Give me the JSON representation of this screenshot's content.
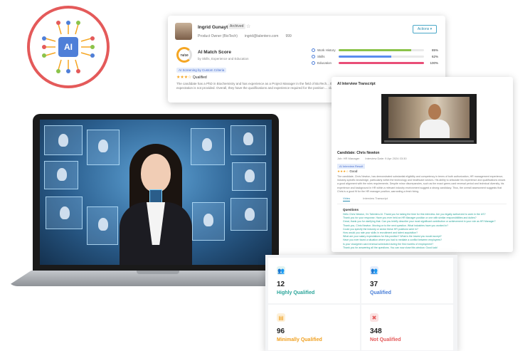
{
  "logo": {
    "text": "AI"
  },
  "profile": {
    "name": "Ingrid Gunayte",
    "badge": "Archived",
    "title": "Product Owner (BioTech)",
    "email": "ingrid@talentero.com",
    "extra": "999",
    "actions_label": "Actions ▾",
    "score_value": "74/10",
    "score_title": "AI Match Score",
    "score_sub": "by Skills, Experience and Education",
    "tag": "AI Screening by Custom Criteria",
    "rating_stars": "★★★☆",
    "rating_label": "Qualified",
    "description": "The candidate has a PhD in Biochemistry and has experience as a Project Manager in the field of BioTech... their salary expectation is not provided. Overall, they have the qualifications and experience required for the position ... clarification.",
    "metrics": [
      {
        "label": "Work History",
        "value": "85%",
        "fraction": 0.85,
        "color": "#8bc34a"
      },
      {
        "label": "Skills",
        "value": "62%",
        "fraction": 0.62,
        "color": "#5b8def"
      },
      {
        "label": "Education",
        "value": "100%",
        "fraction": 1.0,
        "color": "#e94e77"
      }
    ]
  },
  "interview": {
    "title": "AI Interview Transcript",
    "candidate": "Candidate: Chris Newton",
    "meta1": "Job: HR Manager",
    "meta2": "Interview Date: 9 Apr 2024 03:30",
    "tag": "AI Interview Result",
    "rating_stars": "★★★☆",
    "rating_label": "Good",
    "description": "The candidate, Chris Newton, has demonstrated substantial eligibility and competency in terms of both authorization, HR management experience, industry-specific knowledge, particularly within the technology and healthcare sectors. His ability to articulate his experience and qualifications shows a good alignment with the roles requirements. Despite minor discrepancies, such as the exact green-card renewal period and technical diversity, his experience and background in HR within a relevant industry environment suggest a strong candidacy. Thus, the overall assessment suggests that Chris is a good fit for the HR manager position, warranting a fresh hiring.",
    "tab_active": "Video",
    "tab_other": "Interview Transcript",
    "questions_label": "Questions",
    "questions": [
      "Hello Chris Newton, I'm Talentero AI. Thank you for taking the time for this interview. Are you legally authorized to work in the US?",
      "Thank you for your response. Have you ever held an HR Manager position or one with similar responsibilities and duties?",
      "Great, thank you for clarifying that. Can you briefly describe your most significant contribution or achievement in your role as HR Manager?",
      "Thank you, Chris Newton. Moving on to the next question. What industries have you worked in?",
      "Could you specify the industry or sector these HR positions were in?",
      "How would you rate your skills in recruitment and talent acquisition?",
      "What are your salary expectations for this position? What is the lowest you would accept?",
      "Have you ever faced a situation where you had to mediate a conflict between employees?",
      "Is your visa/green card renewal scheduled during the first months of employment?",
      "Thank you for answering all the questions. You can now close this window. Good luck!"
    ]
  },
  "stats": [
    {
      "icon": "👥",
      "count": "12",
      "label": "Highly Qualified",
      "color": "#2aa59a",
      "bg": "#e0f3f1"
    },
    {
      "icon": "👥",
      "count": "37",
      "label": "Qualified",
      "color": "#4a7fd8",
      "bg": "#e3ecfb"
    },
    {
      "icon": "▤",
      "count": "96",
      "label": "Minimally Qualified",
      "color": "#f0a020",
      "bg": "#fdf0d9"
    },
    {
      "icon": "✖",
      "count": "348",
      "label": "Not Qualified",
      "color": "#e45a5a",
      "bg": "#fbe2e2"
    }
  ]
}
